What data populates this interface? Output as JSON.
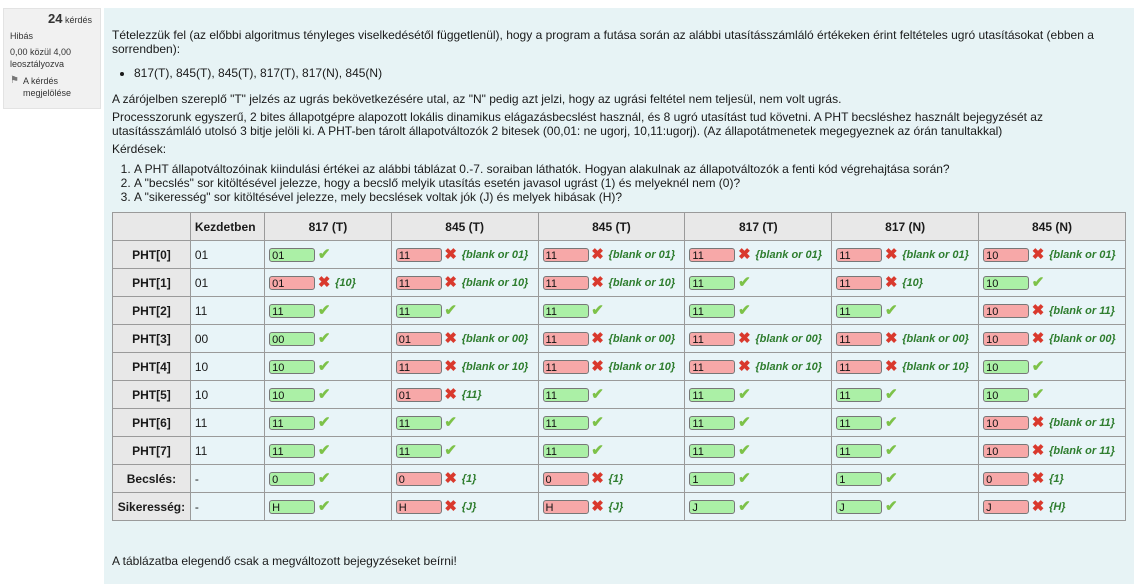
{
  "info": {
    "number": "24",
    "number_label": "kérdés",
    "status": "Hibás",
    "grade": "0,00 közül 4,00 leosztályozva",
    "flag_label": "A kérdés megjelölése"
  },
  "question": {
    "intro": "Tételezzük fel (az előbbi algoritmus tényleges viselkedésétől függetlenül), hogy a program a futása során az alábbi utasításszámláló értékeken érint feltételes ugró utasításokat (ebben a sorrendben):",
    "sequence": "817(T), 845(T), 845(T), 817(T), 817(N), 845(N)",
    "p1": "A zárójelben szereplő \"T\" jelzés az ugrás bekövetkezésére utal, az \"N\" pedig azt jelzi, hogy az ugrási feltétel nem teljesül, nem volt ugrás.",
    "p2": "Processzorunk egyszerű, 2 bites állapotgépre alapozott lokális dinamikus elágazásbecslést használ, és 8 ugró utasítást tud követni. A PHT becsléshez használt bejegyzését az utasításszámláló utolsó 3 bitje jelöli ki. A PHT-ben tárolt állapotváltozók 2 bitesek (00,01: ne ugorj, 10,11:ugorj). (Az állapotátmenetek megegyeznek az órán tanultakkal)",
    "p3": "Kérdések:",
    "items": [
      "A PHT állapotváltozóinak kiindulási értékei az alábbi táblázat 0.-7. soraiban láthatók. Hogyan alakulnak az állapotváltozók a fenti kód végrehajtása során?",
      "A \"becslés\" sor kitöltésével jelezze, hogy a becslő melyik utasítás esetén javasol ugrást (1) és melyeknél nem (0)?",
      "A \"sikeresség\" sor kitöltésével jelezze, mely becslések voltak jók (J) és melyek hibásak (H)?"
    ],
    "footer": "A táblázatba elegendő csak a megváltozott bejegyzéseket beírni!"
  },
  "table": {
    "headers": [
      "Kezdetben",
      "817 (T)",
      "845 (T)",
      "845 (T)",
      "817 (T)",
      "817 (N)",
      "845 (N)"
    ],
    "rows": [
      {
        "label": "PHT[0]",
        "init": "01",
        "cells": [
          {
            "v": "01",
            "ok": true,
            "c": ""
          },
          {
            "v": "11",
            "ok": false,
            "c": "{blank or 01}"
          },
          {
            "v": "11",
            "ok": false,
            "c": "{blank or 01}"
          },
          {
            "v": "11",
            "ok": false,
            "c": "{blank or 01}"
          },
          {
            "v": "11",
            "ok": false,
            "c": "{blank or 01}"
          },
          {
            "v": "10",
            "ok": false,
            "c": "{blank or 01}"
          }
        ]
      },
      {
        "label": "PHT[1]",
        "init": "01",
        "cells": [
          {
            "v": "01",
            "ok": false,
            "c": "{10}"
          },
          {
            "v": "11",
            "ok": false,
            "c": "{blank or 10}"
          },
          {
            "v": "11",
            "ok": false,
            "c": "{blank or 10}"
          },
          {
            "v": "11",
            "ok": true,
            "c": ""
          },
          {
            "v": "11",
            "ok": false,
            "c": "{10}"
          },
          {
            "v": "10",
            "ok": true,
            "c": ""
          }
        ]
      },
      {
        "label": "PHT[2]",
        "init": "11",
        "cells": [
          {
            "v": "11",
            "ok": true,
            "c": ""
          },
          {
            "v": "11",
            "ok": true,
            "c": ""
          },
          {
            "v": "11",
            "ok": true,
            "c": ""
          },
          {
            "v": "11",
            "ok": true,
            "c": ""
          },
          {
            "v": "11",
            "ok": true,
            "c": ""
          },
          {
            "v": "10",
            "ok": false,
            "c": "{blank or 11}"
          }
        ]
      },
      {
        "label": "PHT[3]",
        "init": "00",
        "cells": [
          {
            "v": "00",
            "ok": true,
            "c": ""
          },
          {
            "v": "01",
            "ok": false,
            "c": "{blank or 00}"
          },
          {
            "v": "11",
            "ok": false,
            "c": "{blank or 00}"
          },
          {
            "v": "11",
            "ok": false,
            "c": "{blank or 00}"
          },
          {
            "v": "11",
            "ok": false,
            "c": "{blank or 00}"
          },
          {
            "v": "10",
            "ok": false,
            "c": "{blank or 00}"
          }
        ]
      },
      {
        "label": "PHT[4]",
        "init": "10",
        "cells": [
          {
            "v": "10",
            "ok": true,
            "c": ""
          },
          {
            "v": "11",
            "ok": false,
            "c": "{blank or 10}"
          },
          {
            "v": "11",
            "ok": false,
            "c": "{blank or 10}"
          },
          {
            "v": "11",
            "ok": false,
            "c": "{blank or 10}"
          },
          {
            "v": "11",
            "ok": false,
            "c": "{blank or 10}"
          },
          {
            "v": "10",
            "ok": true,
            "c": ""
          }
        ]
      },
      {
        "label": "PHT[5]",
        "init": "10",
        "cells": [
          {
            "v": "10",
            "ok": true,
            "c": ""
          },
          {
            "v": "01",
            "ok": false,
            "c": "{11}"
          },
          {
            "v": "11",
            "ok": true,
            "c": ""
          },
          {
            "v": "11",
            "ok": true,
            "c": ""
          },
          {
            "v": "11",
            "ok": true,
            "c": ""
          },
          {
            "v": "10",
            "ok": true,
            "c": ""
          }
        ]
      },
      {
        "label": "PHT[6]",
        "init": "11",
        "cells": [
          {
            "v": "11",
            "ok": true,
            "c": ""
          },
          {
            "v": "11",
            "ok": true,
            "c": ""
          },
          {
            "v": "11",
            "ok": true,
            "c": ""
          },
          {
            "v": "11",
            "ok": true,
            "c": ""
          },
          {
            "v": "11",
            "ok": true,
            "c": ""
          },
          {
            "v": "10",
            "ok": false,
            "c": "{blank or 11}"
          }
        ]
      },
      {
        "label": "PHT[7]",
        "init": "11",
        "cells": [
          {
            "v": "11",
            "ok": true,
            "c": ""
          },
          {
            "v": "11",
            "ok": true,
            "c": ""
          },
          {
            "v": "11",
            "ok": true,
            "c": ""
          },
          {
            "v": "11",
            "ok": true,
            "c": ""
          },
          {
            "v": "11",
            "ok": true,
            "c": ""
          },
          {
            "v": "10",
            "ok": false,
            "c": "{blank or 11}"
          }
        ]
      },
      {
        "label": "Becslés:",
        "init": "-",
        "cells": [
          {
            "v": "0",
            "ok": true,
            "c": ""
          },
          {
            "v": "0",
            "ok": false,
            "c": "{1}"
          },
          {
            "v": "0",
            "ok": false,
            "c": "{1}"
          },
          {
            "v": "1",
            "ok": true,
            "c": ""
          },
          {
            "v": "1",
            "ok": true,
            "c": ""
          },
          {
            "v": "0",
            "ok": false,
            "c": "{1}"
          }
        ]
      },
      {
        "label": "Sikeresség:",
        "init": "-",
        "cells": [
          {
            "v": "H",
            "ok": true,
            "c": ""
          },
          {
            "v": "H",
            "ok": false,
            "c": "{J}"
          },
          {
            "v": "H",
            "ok": false,
            "c": "{J}"
          },
          {
            "v": "J",
            "ok": true,
            "c": ""
          },
          {
            "v": "J",
            "ok": true,
            "c": ""
          },
          {
            "v": "J",
            "ok": false,
            "c": "{H}"
          }
        ]
      }
    ]
  },
  "colors": {
    "correct": "#abf0a6",
    "incorrect": "#f7a8a8",
    "check": "#7dc249",
    "cross": "#d9392d",
    "panel": "#e7f3f5"
  },
  "icons": {
    "check": "✔",
    "cross": "✖",
    "flag": "⚑"
  }
}
